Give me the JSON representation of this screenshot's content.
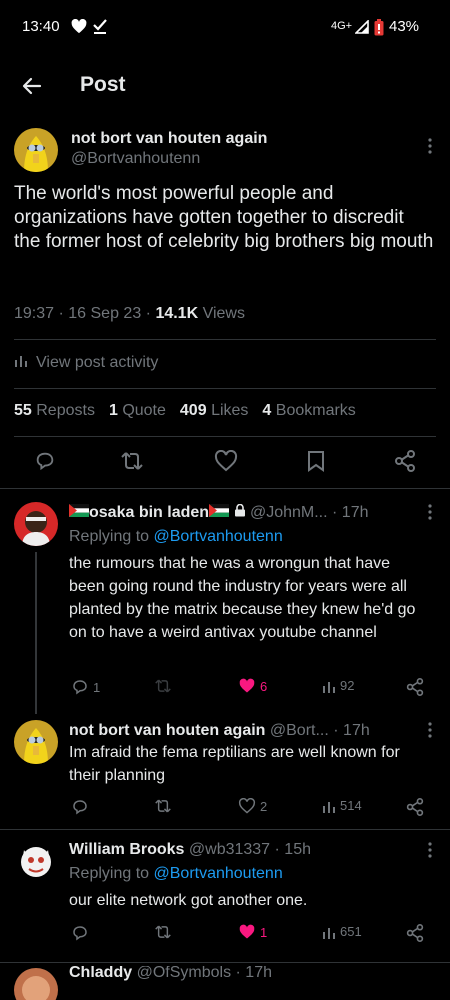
{
  "status_bar": {
    "time": "13:40",
    "network": "4G+",
    "battery": "43%"
  },
  "header": {
    "title": "Post"
  },
  "post": {
    "author_name": "not bort van houten again",
    "author_handle": "@Bortvanhoutenn",
    "text": "The world's most powerful people and organizations have gotten together to discredit the former host of celebrity big brothers big mouth",
    "time": "19:37 · 16 Sep 23 ·",
    "views_count": "14.1K",
    "views_label": "Views",
    "activity_label": "View post activity",
    "reposts_count": "55",
    "reposts_label": "Reposts",
    "quotes_count": "1",
    "quotes_label": "Quote",
    "likes_count": "409",
    "likes_label": "Likes",
    "bookmarks_count": "4",
    "bookmarks_label": "Bookmarks"
  },
  "replies": [
    {
      "name": "osaka bin laden",
      "handle": "@JohnM...",
      "time": "· 17h",
      "replying_prefix": "Replying to",
      "replying_to": "@Bortvanhoutenn",
      "text": "the rumours that he was a wrongun that have been going round the industry for years were all planted by the matrix because they knew he'd go on to have a weird antivax youtube channel",
      "replies": "1",
      "reposts": "",
      "likes": "6",
      "views": "92"
    },
    {
      "name": "not bort van houten again",
      "handle": "@Bort...",
      "time": "· 17h",
      "text": "Im afraid the fema reptilians are well known for their planning",
      "replies": "",
      "reposts": "",
      "likes": "2",
      "views": "514"
    },
    {
      "name": "William Brooks",
      "handle": "@wb31337",
      "time": "· 15h",
      "replying_prefix": "Replying to",
      "replying_to": "@Bortvanhoutenn",
      "text": "our elite network got another one.",
      "replies": "",
      "reposts": "",
      "likes": "1",
      "views": "651"
    },
    {
      "name": "Chladdy",
      "handle": "@OfSymbols",
      "time": "· 17h"
    }
  ],
  "colors": {
    "background": "#000000",
    "text": "#e7e9ea",
    "muted": "#71767b",
    "link": "#1d9bf0",
    "like": "#f91880",
    "divider": "#2f3336"
  }
}
